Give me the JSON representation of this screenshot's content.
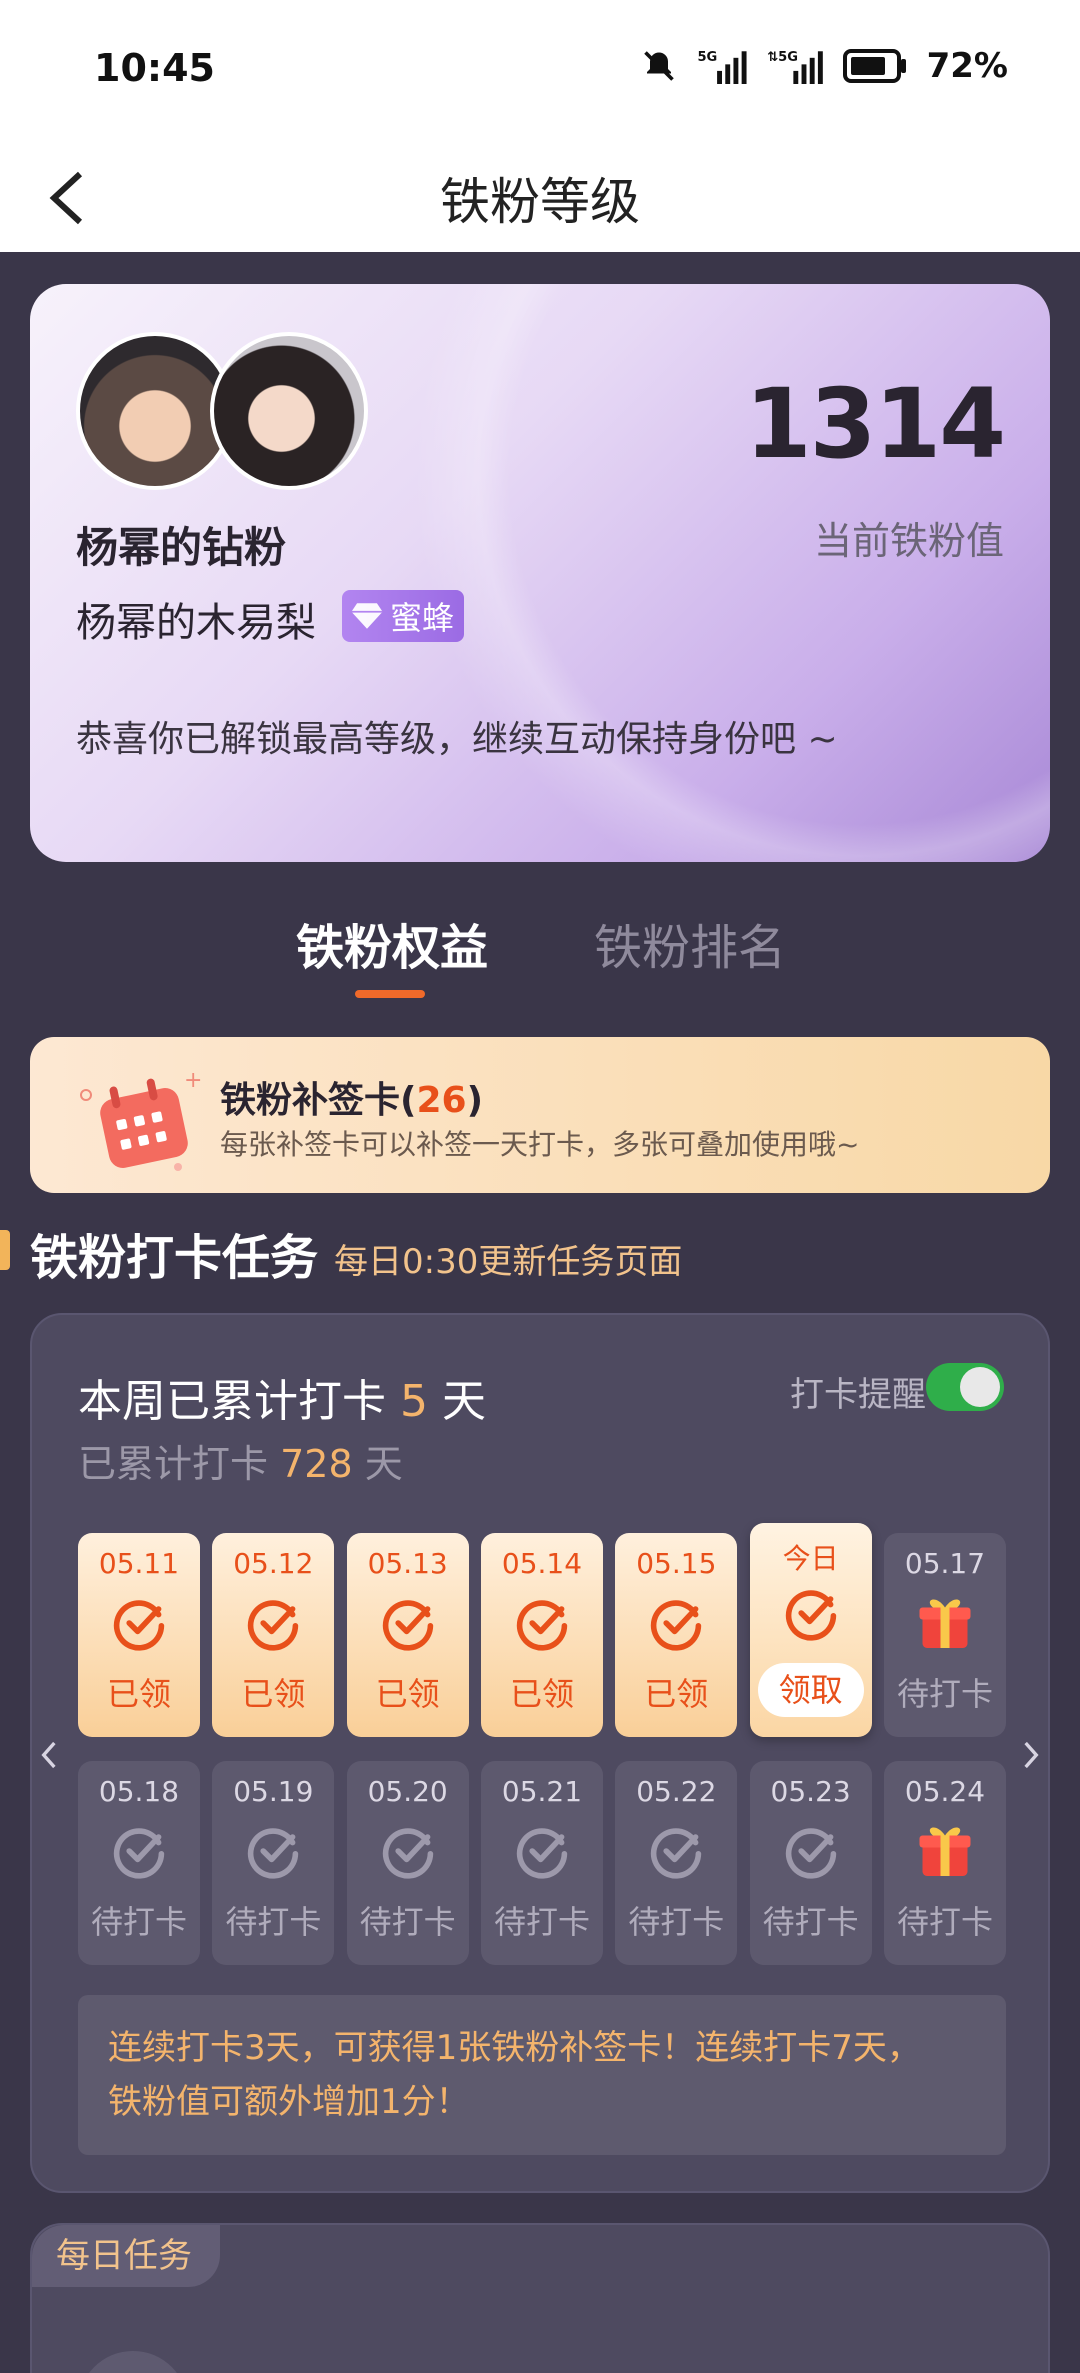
{
  "status_bar": {
    "time": "10:45",
    "battery": "72%"
  },
  "header": {
    "title": "铁粉等级"
  },
  "profile": {
    "fan_title": "杨幂的钻粉",
    "fan_name": "杨幂的木易梨",
    "badge": "蜜蜂",
    "score": "1314",
    "score_label": "当前铁粉值",
    "message": "恭喜你已解锁最高等级，继续互动保持身份吧 ~"
  },
  "tabs": [
    {
      "label": "铁粉权益",
      "active": true
    },
    {
      "label": "铁粉排名",
      "active": false
    }
  ],
  "makeup_card": {
    "title": "铁粉补签卡",
    "count": "26",
    "subtitle": "每张补签卡可以补签一天打卡，多张可叠加使用哦~"
  },
  "checkin_section": {
    "title": "铁粉打卡任务",
    "subtitle": "每日0:30更新任务页面"
  },
  "checkin": {
    "week_prefix": "本周已累计打卡",
    "week_days": "5",
    "week_suffix": "天",
    "total_prefix": "已累计打卡",
    "total_days": "728",
    "total_suffix": "天",
    "reminder_label": "打卡提醒",
    "reminder_on": true,
    "row1": [
      {
        "date": "05.11",
        "status": "claimed",
        "label": "已领"
      },
      {
        "date": "05.12",
        "status": "claimed",
        "label": "已领"
      },
      {
        "date": "05.13",
        "status": "claimed",
        "label": "已领"
      },
      {
        "date": "05.14",
        "status": "claimed",
        "label": "已领"
      },
      {
        "date": "05.15",
        "status": "claimed",
        "label": "已领"
      },
      {
        "date": "今日",
        "status": "today",
        "label": "领取"
      },
      {
        "date": "05.17",
        "status": "pending-gift",
        "label": "待打卡"
      }
    ],
    "row2": [
      {
        "date": "05.18",
        "status": "pending",
        "label": "待打卡"
      },
      {
        "date": "05.19",
        "status": "pending",
        "label": "待打卡"
      },
      {
        "date": "05.20",
        "status": "pending",
        "label": "待打卡"
      },
      {
        "date": "05.21",
        "status": "pending",
        "label": "待打卡"
      },
      {
        "date": "05.22",
        "status": "pending",
        "label": "待打卡"
      },
      {
        "date": "05.23",
        "status": "pending",
        "label": "待打卡"
      },
      {
        "date": "05.24",
        "status": "pending-gift",
        "label": "待打卡"
      }
    ],
    "note_line1": "连续打卡3天，可获得1张铁粉补签卡！连续打卡7天，",
    "note_line2": "铁粉值可额外增加1分！"
  },
  "daily_tasks": {
    "tag": "每日任务"
  },
  "colors": {
    "accent": "#e8501a",
    "highlight": "#f4b46c",
    "toggle_on": "#2fae4a",
    "background": "#3a3649"
  }
}
